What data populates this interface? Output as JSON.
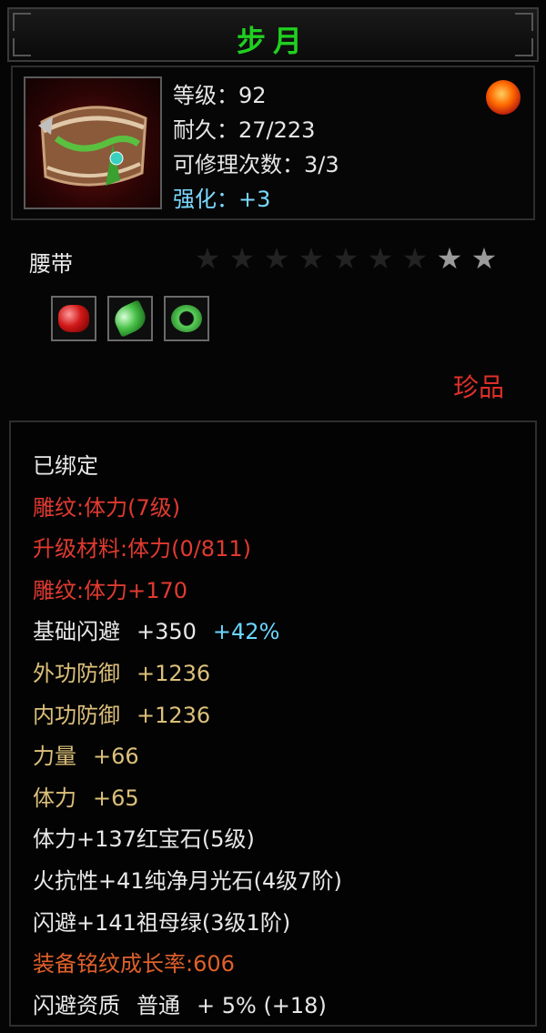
{
  "item": {
    "name": "步月",
    "type": "腰带",
    "rarity": "珍品",
    "icon": "belt-icon",
    "emblem_icon": "fire-dragon-emblem-icon",
    "name_color": "#20d020"
  },
  "stats": {
    "level_label": "等级：",
    "level_value": "92",
    "durability_label": "耐久：",
    "durability_value": "27/223",
    "repair_label": "可修理次数：",
    "repair_value": "3/3",
    "enhance_label": "强化：",
    "enhance_value": "+3"
  },
  "stars": {
    "total": 9,
    "lit": 2
  },
  "gems": [
    "ruby-gem-icon",
    "emerald-gem-icon",
    "jade-ring-gem-icon"
  ],
  "attributes": {
    "bound": "已绑定",
    "engrave1": "雕纹:体力(7级)",
    "upgrade_material": "升级材料:体力(0/811)",
    "engrave2": "雕纹:体力+170",
    "base_dodge_label": "基础闪避",
    "base_dodge_value": "+350",
    "base_dodge_bonus": "+42%",
    "outer_def_label": "外功防御",
    "outer_def_value": "+1236",
    "inner_def_label": "内功防御",
    "inner_def_value": "+1236",
    "strength_label": "力量",
    "strength_value": "+66",
    "stamina_label": "体力",
    "stamina_value": "+65",
    "gem1": "体力+137红宝石(5级)",
    "gem2": "火抗性+41纯净月光石(4级7阶)",
    "gem3": "闪避+141祖母绿(3级1阶)",
    "growth": "装备铭纹成长率:606",
    "aptitude_label": "闪避资质",
    "aptitude_grade": "普通",
    "aptitude_value": "+ 5% (+18)"
  },
  "colors": {
    "white": "#e8e8e8",
    "red": "#e03a30",
    "tan": "#dcc07a",
    "cyan": "#6ad6ff",
    "orange": "#e0602a"
  }
}
